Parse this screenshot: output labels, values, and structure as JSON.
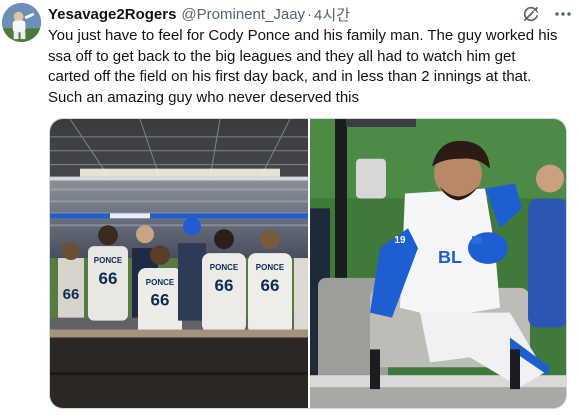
{
  "author": {
    "display_name": "Yesavage2Rogers",
    "handle": "@Prominent_Jaay",
    "separator": "·",
    "timestamp": "4시간"
  },
  "icons": {
    "avatar": "user-avatar",
    "grok": "grok-icon",
    "more": "more-icon"
  },
  "tweet": {
    "text": "You just have to feel for Cody Ponce and his family man. The guy worked his\nssa off to get back to the big leagues and they all had to watch him get\ncarted off the field on his first day back, and in less than 2 innings at that.\nSuch an amazing guy who never deserved this"
  },
  "media": {
    "left_photo": {
      "jersey_name": "PONCE",
      "jersey_number": "66"
    },
    "right_photo": {
      "jersey_text": "BL",
      "jersey_number": "19"
    }
  },
  "colors": {
    "text_primary": "#0f1419",
    "text_secondary": "#536471",
    "jays_blue": "#134a8e",
    "jays_royal": "#1d5fd1"
  }
}
